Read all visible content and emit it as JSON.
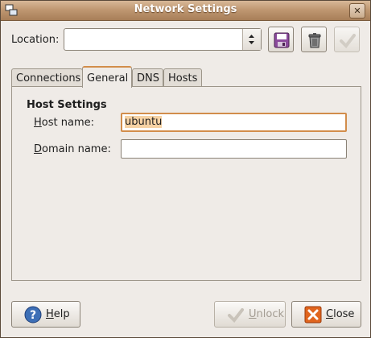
{
  "window": {
    "title": "Network Settings"
  },
  "location": {
    "label": "Location:",
    "value": ""
  },
  "toolbar": {
    "save_icon": "floppy-disk-icon",
    "delete_icon": "trash-can-icon",
    "apply_icon": "checkmark-icon"
  },
  "tabs": [
    {
      "label": "Connections",
      "active": false
    },
    {
      "label": "General",
      "active": true
    },
    {
      "label": "DNS",
      "active": false
    },
    {
      "label": "Hosts",
      "active": false
    }
  ],
  "host_settings": {
    "heading": "Host Settings",
    "host_name": {
      "mnemonic": "H",
      "label_rest": "ost name:",
      "value": "ubuntu"
    },
    "domain_name": {
      "mnemonic": "D",
      "label_rest": "omain name:",
      "value": ""
    }
  },
  "buttons": {
    "help": {
      "mnemonic": "H",
      "label_rest": "elp"
    },
    "unlock": {
      "mnemonic": "U",
      "label_rest": "nlock",
      "disabled": true
    },
    "close": {
      "mnemonic": "C",
      "label_rest": "lose"
    }
  },
  "colors": {
    "titlebar": "#c09872",
    "focus_accent": "#d28d4b",
    "selection": "#f6d2a4",
    "help_blue": "#3d6fb6",
    "close_orange": "#e0651e"
  }
}
